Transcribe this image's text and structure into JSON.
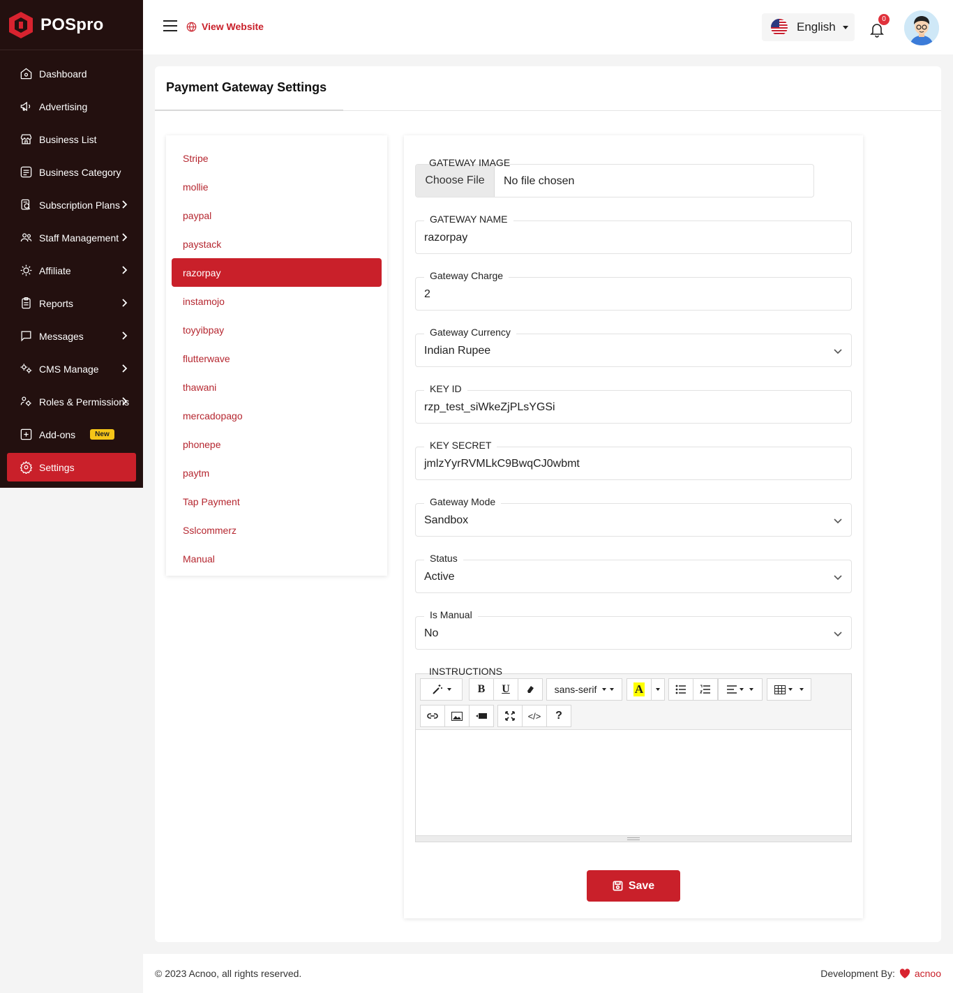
{
  "brand": {
    "name": "POSpro"
  },
  "sidebar": {
    "items": [
      {
        "label": "Dashboard",
        "icon": "home-icon",
        "has_chevron": false
      },
      {
        "label": "Advertising",
        "icon": "megaphone-icon",
        "has_chevron": false
      },
      {
        "label": "Business List",
        "icon": "store-icon",
        "has_chevron": false
      },
      {
        "label": "Business Category",
        "icon": "list-box-icon",
        "has_chevron": false
      },
      {
        "label": "Subscription Plans",
        "icon": "badge-icon",
        "has_chevron": true
      },
      {
        "label": "Staff Management",
        "icon": "users-icon",
        "has_chevron": true
      },
      {
        "label": "Affiliate",
        "icon": "sun-icon",
        "has_chevron": true
      },
      {
        "label": "Reports",
        "icon": "clipboard-icon",
        "has_chevron": true
      },
      {
        "label": "Messages",
        "icon": "message-icon",
        "has_chevron": true
      },
      {
        "label": "CMS Manage",
        "icon": "gears-icon",
        "has_chevron": true
      },
      {
        "label": "Roles & Permissions",
        "icon": "roles-icon",
        "has_chevron": true
      },
      {
        "label": "Add-ons",
        "icon": "plus-square-icon",
        "has_chevron": false,
        "badge": "New"
      },
      {
        "label": "Settings",
        "icon": "gear-icon",
        "has_chevron": false,
        "active": true
      }
    ]
  },
  "header": {
    "view_website": "View Website",
    "language": "English",
    "notification_count": "0"
  },
  "page": {
    "title": "Payment Gateway Settings"
  },
  "gateways": {
    "items": [
      "Stripe",
      "mollie",
      "paypal",
      "paystack",
      "razorpay",
      "instamojo",
      "toyyibpay",
      "flutterwave",
      "thawani",
      "mercadopago",
      "phonepe",
      "paytm",
      "Tap Payment",
      "Sslcommerz",
      "Manual"
    ],
    "active": "razorpay"
  },
  "form": {
    "gateway_image": {
      "label": "GATEWAY IMAGE",
      "button": "Choose File",
      "file": "No file chosen"
    },
    "gateway_name": {
      "label": "GATEWAY NAME",
      "value": "razorpay"
    },
    "gateway_charge": {
      "label": "Gateway Charge",
      "value": "2"
    },
    "gateway_currency": {
      "label": "Gateway Currency",
      "value": "Indian Rupee"
    },
    "key_id": {
      "label": "KEY ID",
      "value": "rzp_test_siWkeZjPLsYGSi"
    },
    "key_secret": {
      "label": "KEY SECRET",
      "value": "jmlzYyrRVMLkC9BwqCJ0wbmt"
    },
    "gateway_mode": {
      "label": "Gateway Mode",
      "value": "Sandbox"
    },
    "status": {
      "label": "Status",
      "value": "Active"
    },
    "is_manual": {
      "label": "Is Manual",
      "value": "No"
    },
    "instructions": {
      "label": "INSTRUCTIONS",
      "font_family": "sans-serif"
    },
    "save": "Save"
  },
  "footer": {
    "copyright": "© 2023 Acnoo, all rights reserved.",
    "dev_label": "Development By:",
    "dev_brand": "acnoo"
  },
  "colors": {
    "accent": "#c9202a",
    "sidebar_bg": "#23100f",
    "badge": "#f5c518"
  }
}
